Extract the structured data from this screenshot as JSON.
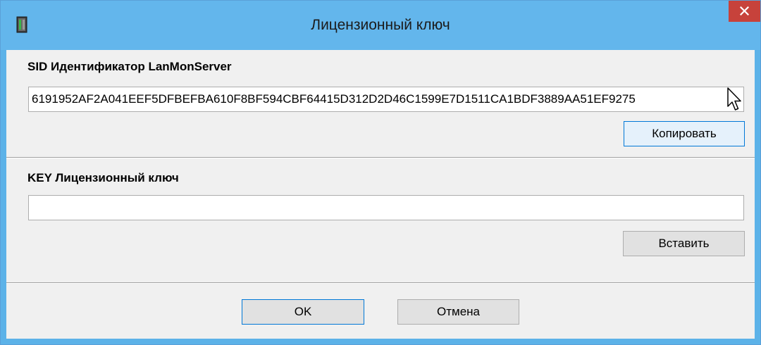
{
  "window": {
    "title": "Лицензионный ключ"
  },
  "sid": {
    "label": "SID Идентификатор LanMonServer",
    "value": "6191952AF2A041EEF5DFBEFBA610F8BF594CBF64415D312D2D46C1599E7D1511CA1BDF3889AA51EF9275",
    "copy_label": "Копировать"
  },
  "key": {
    "label": "KEY Лицензионный ключ",
    "value": "",
    "paste_label": "Вставить"
  },
  "footer": {
    "ok_label": "OK",
    "cancel_label": "Отмена"
  },
  "icons": {
    "app": "server-icon",
    "close": "close-icon",
    "cursor": "mouse-pointer-icon"
  },
  "colors": {
    "titlebar": "#63b6ec",
    "close_button": "#c7423b",
    "client_bg": "#f0f0f0",
    "focus_border": "#0078d7"
  }
}
